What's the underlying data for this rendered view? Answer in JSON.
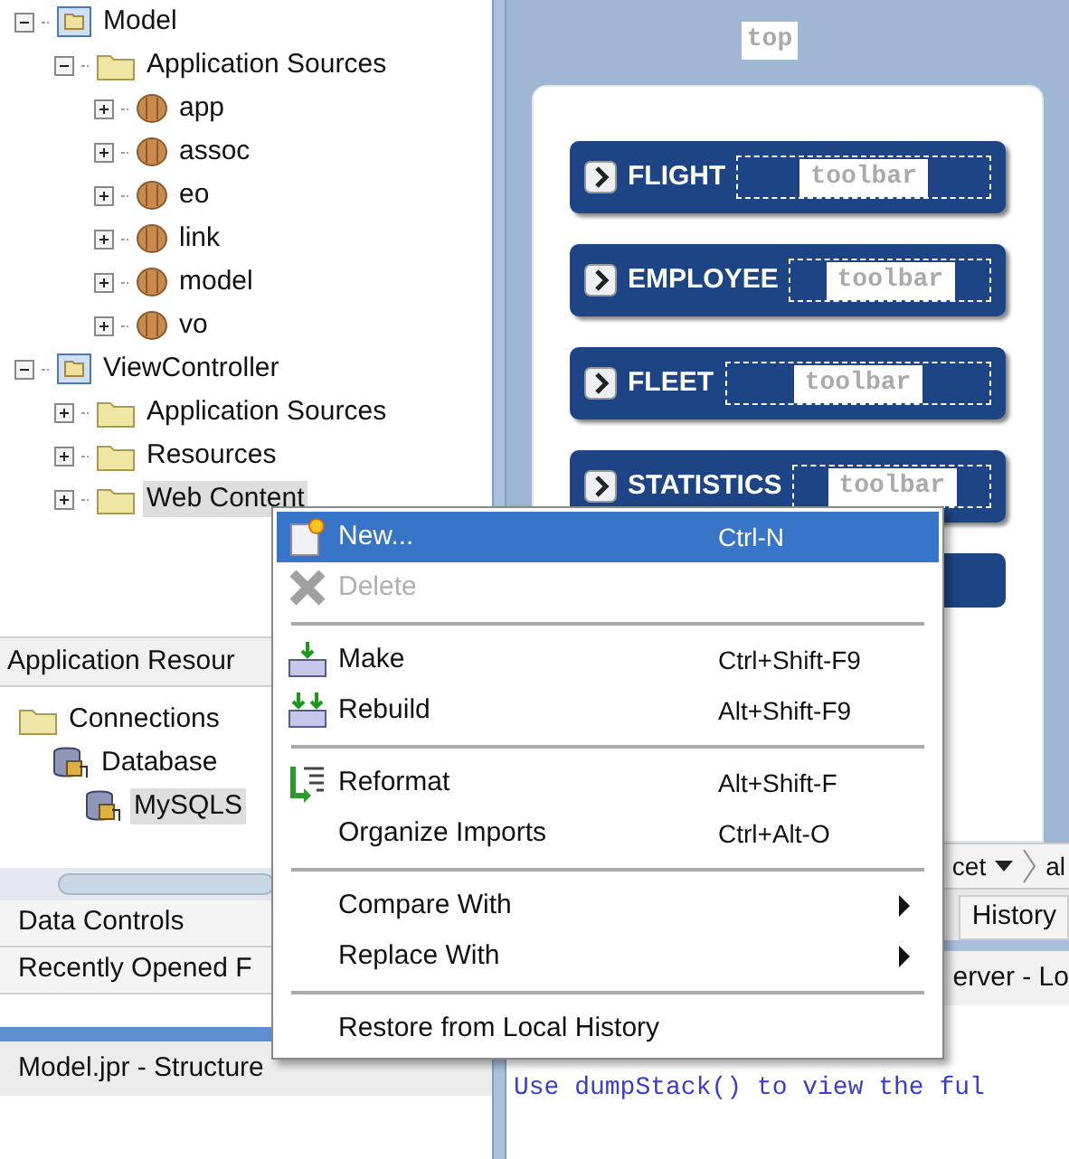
{
  "project_tree": [
    {
      "label": "Model",
      "kind": "project",
      "expanded": true,
      "selected": false,
      "children": [
        {
          "label": "Application Sources",
          "kind": "folder",
          "expanded": true,
          "selected": false,
          "children": [
            {
              "label": "app",
              "kind": "package",
              "expanded": false,
              "selected": false
            },
            {
              "label": "assoc",
              "kind": "package",
              "expanded": false,
              "selected": false
            },
            {
              "label": "eo",
              "kind": "package",
              "expanded": false,
              "selected": false
            },
            {
              "label": "link",
              "kind": "package",
              "expanded": false,
              "selected": false
            },
            {
              "label": "model",
              "kind": "package",
              "expanded": false,
              "selected": false
            },
            {
              "label": "vo",
              "kind": "package",
              "expanded": false,
              "selected": false
            }
          ]
        }
      ]
    },
    {
      "label": "ViewController",
      "kind": "project",
      "expanded": true,
      "selected": false,
      "children": [
        {
          "label": "Application Sources",
          "kind": "folder",
          "expanded": false,
          "selected": false
        },
        {
          "label": "Resources",
          "kind": "folder",
          "expanded": false,
          "selected": false
        },
        {
          "label": "Web Content",
          "kind": "folder",
          "expanded": false,
          "selected": true
        }
      ]
    }
  ],
  "resources_panel": {
    "title": "Application Resour",
    "tree": [
      {
        "label": "Connections",
        "kind": "folder",
        "selected": false,
        "children": [
          {
            "label": "Database",
            "kind": "database",
            "selected": false,
            "children": [
              {
                "label": "MySQLS",
                "kind": "database",
                "selected": true
              }
            ]
          }
        ]
      }
    ]
  },
  "collapsed_panels": [
    "Data Controls",
    "Recently Opened F"
  ],
  "structure_tab": "Model.jpr - Structure",
  "design": {
    "facet": "top",
    "sections": [
      {
        "title": "FLIGHT",
        "facet": "toolbar"
      },
      {
        "title": "EMPLOYEE",
        "facet": "toolbar"
      },
      {
        "title": "FLEET",
        "facet": "toolbar"
      },
      {
        "title": "STATISTICS",
        "facet": "toolbar"
      }
    ]
  },
  "breadcrumb": [
    "cet",
    "al"
  ],
  "editor_tabs": [
    {
      "label": "History"
    }
  ],
  "log_tab": "erver - Lo",
  "log_lines": [
    "Use dumpStack() to view the ful"
  ],
  "context_menu": [
    {
      "kind": "item",
      "label": "New...",
      "shortcut": "Ctrl-N",
      "selected": true,
      "disabled": false
    },
    {
      "kind": "item",
      "label": "Delete",
      "selected": false,
      "disabled": true
    },
    {
      "kind": "separator"
    },
    {
      "kind": "item",
      "label": "Make",
      "shortcut": "Ctrl+Shift-F9",
      "selected": false,
      "disabled": false
    },
    {
      "kind": "item",
      "label": "Rebuild",
      "shortcut": "Alt+Shift-F9",
      "selected": false,
      "disabled": false
    },
    {
      "kind": "separator"
    },
    {
      "kind": "item",
      "label": "Reformat",
      "shortcut": "Alt+Shift-F",
      "selected": false,
      "disabled": false
    },
    {
      "kind": "item",
      "label": "Organize Imports",
      "shortcut": "Ctrl+Alt-O",
      "selected": false,
      "disabled": false
    },
    {
      "kind": "separator"
    },
    {
      "kind": "item",
      "label": "Compare With",
      "submenu": true,
      "selected": false,
      "disabled": false
    },
    {
      "kind": "item",
      "label": "Replace With",
      "submenu": true,
      "selected": false,
      "disabled": false
    },
    {
      "kind": "separator"
    },
    {
      "kind": "item",
      "label": "Restore from Local History",
      "selected": false,
      "disabled": false
    }
  ]
}
